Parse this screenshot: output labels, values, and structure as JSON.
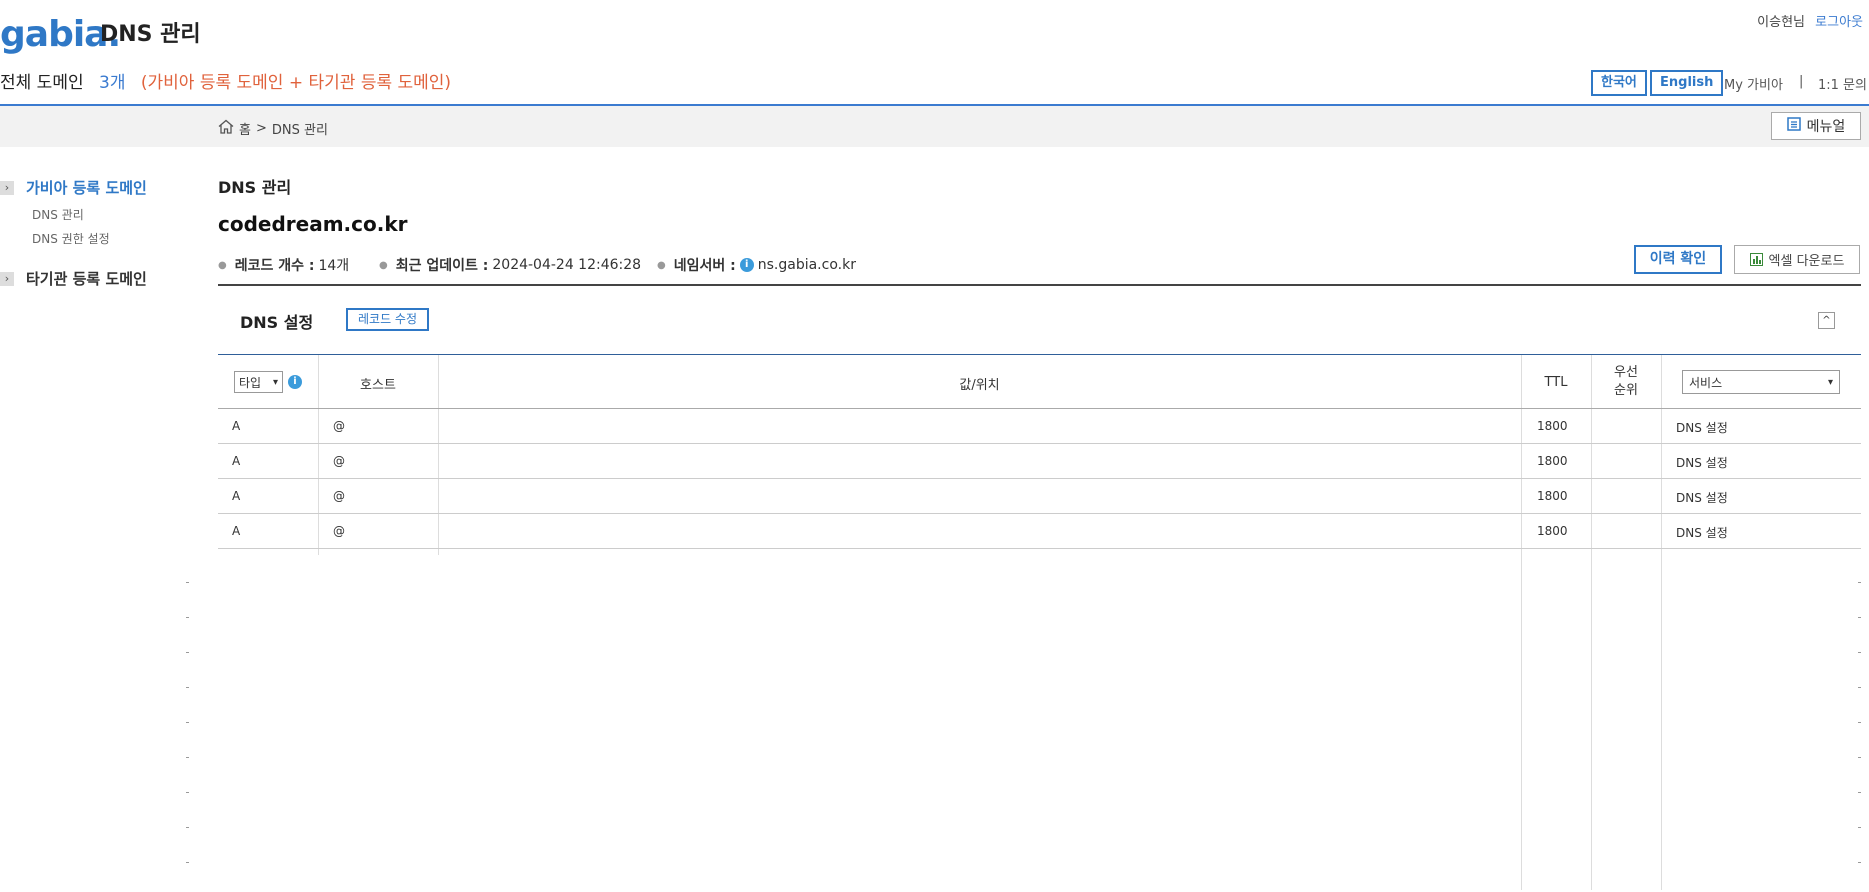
{
  "header": {
    "logo_text": "gabia.",
    "app_title": "DNS 관리",
    "user_name": "이승현님",
    "logout_label": "로그아웃",
    "lang_ko": "한국어",
    "lang_en": "English",
    "my_gabia": "My 가비아",
    "separator": "|",
    "inquiry": "1:1 문의"
  },
  "summary": {
    "label": "전체 도메인",
    "count": "3개",
    "desc": "(가비아 등록 도메인 + 타기관 등록 도메인)"
  },
  "breadcrumb": {
    "home": "홈",
    "sep": ">",
    "current": "DNS 관리"
  },
  "manual_label": "메뉴얼",
  "sidebar": {
    "items": [
      {
        "label": "가비아 등록 도메인",
        "active": true,
        "subitems": [
          "DNS 관리",
          "DNS 권한 설정"
        ]
      },
      {
        "label": "타기관 등록 도메인",
        "active": false,
        "subitems": []
      }
    ]
  },
  "main": {
    "section_title": "DNS 관리",
    "domain": "codedream.co.kr",
    "record_count_label": "레코드 개수 :",
    "record_count": "14개",
    "updated_label": "최근 업데이트 :",
    "updated": "2024-04-24 12:46:28",
    "ns_label": "네임서버 :",
    "ns_value": "ns.gabia.co.kr",
    "history_btn": "이력 확인",
    "excel_btn": "엑셀 다운로드"
  },
  "dns_settings": {
    "title": "DNS 설정",
    "edit_btn": "레코드 수정",
    "collapse_glyph": "^"
  },
  "table": {
    "type_select": "타입",
    "headers": {
      "host": "호스트",
      "value": "값/위치",
      "ttl": "TTL",
      "priority_1": "우선",
      "priority_2": "순위"
    },
    "service_select": "서비스",
    "rows": [
      {
        "type": "A",
        "host": "@",
        "ttl": "1800",
        "service": "DNS 설정"
      },
      {
        "type": "A",
        "host": "@",
        "ttl": "1800",
        "service": "DNS 설정"
      },
      {
        "type": "A",
        "host": "@",
        "ttl": "1800",
        "service": "DNS 설정"
      },
      {
        "type": "A",
        "host": "@",
        "ttl": "1800",
        "service": "DNS 설정"
      }
    ]
  },
  "colors": {
    "brand_blue": "#2f78c6",
    "accent_orange": "#e0623c",
    "info_blue": "#3b9bdb"
  }
}
